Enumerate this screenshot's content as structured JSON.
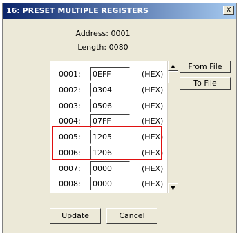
{
  "dialog": {
    "title": "16: PRESET MULTIPLE REGISTERS",
    "close_label": "X",
    "address_label": "Address:",
    "address_value": "0001",
    "length_label": "Length:",
    "length_value": "0080"
  },
  "registers": [
    {
      "addr": "0001:",
      "value": "0EFF",
      "format": "(HEX)"
    },
    {
      "addr": "0002:",
      "value": "0304",
      "format": "(HEX)"
    },
    {
      "addr": "0003:",
      "value": "0506",
      "format": "(HEX)"
    },
    {
      "addr": "0004:",
      "value": "07FF",
      "format": "(HEX)"
    },
    {
      "addr": "0005:",
      "value": "1205",
      "format": "(HEX)"
    },
    {
      "addr": "0006:",
      "value": "1206",
      "format": "(HEX)"
    },
    {
      "addr": "0007:",
      "value": "0000",
      "format": "(HEX)"
    },
    {
      "addr": "0008:",
      "value": "0000",
      "format": "(HEX)"
    }
  ],
  "buttons": {
    "from_file": "From File",
    "to_file": "To File",
    "update_first": "U",
    "update_rest": "pdate",
    "cancel_first": "C",
    "cancel_rest": "ancel"
  },
  "highlight_color": "#e01010"
}
